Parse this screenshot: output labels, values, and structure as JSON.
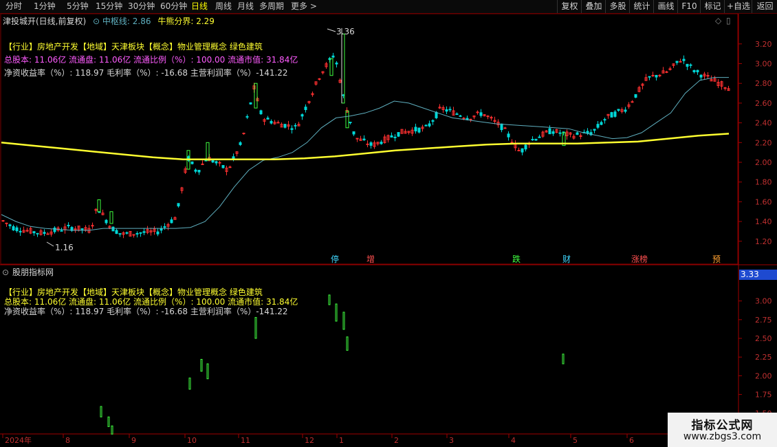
{
  "toolbar": {
    "periods": [
      "分时",
      "1分钟",
      "5分钟",
      "15分钟",
      "30分钟",
      "60分钟",
      "日线",
      "周线",
      "月线",
      "多周期",
      "更多 >"
    ],
    "active": "日线",
    "buttons": [
      "复权",
      "叠加",
      "多股",
      "统计",
      "画线",
      "F10",
      "标记",
      "+自选",
      "返回"
    ]
  },
  "main": {
    "stock_title": "津投城开(日线,前复权)",
    "zhongshu_label": "中枢线:",
    "zhongshu_value": "2.86",
    "niuxiong_label": "牛熊分界:",
    "niuxiong_value": "2.29",
    "info_line1": "【行业】房地产开发【地域】天津板块【概念】物业管理概念 绿色建筑",
    "info_line2": "总股本: 11.06亿 流通盘: 11.06亿 流通比例（%）: 100.00 流通市值: 31.84亿",
    "info_line3": "净资收益率（%）: 118.97 毛利率（%）: -16.68 主营利润率（%）-141.22",
    "high_label": "3.36",
    "low_label": "1.16",
    "event_tags": [
      "停",
      "增",
      "跌",
      "财",
      "涨榜",
      "预"
    ]
  },
  "indicator": {
    "title": "股朋指标网",
    "current_value": "3.33",
    "info_line1": "【行业】房地产开发【地域】天津板块【概念】物业管理概念 绿色建筑",
    "info_line2": "总股本: 11.06亿 流通盘: 11.06亿 流通比例（%）: 100.00 流通市值: 31.84亿",
    "info_line3": "净资收益率（%）: 118.97 毛利率（%）: -16.68 主营利润率（%）-141.22"
  },
  "x_axis_labels": [
    "2024年",
    "8",
    "9",
    "10",
    "11",
    "12",
    "1",
    "2",
    "3",
    "4",
    "5",
    "6"
  ],
  "watermark": {
    "line1": "指标公式网",
    "line2": "www.zbgs3.com"
  },
  "chart_data": [
    {
      "type": "candlestick",
      "title": "津投城开(日线,前复权)",
      "ylim": [
        1.08,
        3.38
      ],
      "yticks": [
        1.2,
        1.4,
        1.6,
        1.8,
        2.0,
        2.2,
        2.4,
        2.6,
        2.8,
        3.0,
        3.2
      ],
      "x_labels": [
        "2024年",
        "8",
        "9",
        "10",
        "11",
        "12",
        "1",
        "2",
        "3",
        "4",
        "5",
        "6"
      ],
      "series": [
        {
          "name": "中枢线",
          "color": "#5fb0c0",
          "values": [
            1.47,
            1.4,
            1.35,
            1.33,
            1.32,
            1.31,
            1.31,
            1.33,
            1.33,
            1.33,
            1.33,
            1.33,
            1.33,
            1.34,
            1.4,
            1.55,
            1.75,
            1.92,
            2.02,
            2.05,
            2.1,
            2.2,
            2.35,
            2.45,
            2.47,
            2.5,
            2.55,
            2.62,
            2.6,
            2.55,
            2.5,
            2.45,
            2.43,
            2.41,
            2.39,
            2.38,
            2.37,
            2.36,
            2.35,
            2.34,
            2.3,
            2.27,
            2.24,
            2.25,
            2.3,
            2.4,
            2.5,
            2.7,
            2.83,
            2.86,
            2.86
          ]
        },
        {
          "name": "牛熊分界",
          "color": "#ffff30",
          "values": [
            2.2,
            2.17,
            2.14,
            2.11,
            2.08,
            2.05,
            2.03,
            2.03,
            2.03,
            2.03,
            2.04,
            2.06,
            2.09,
            2.12,
            2.14,
            2.16,
            2.18,
            2.19,
            2.19,
            2.19,
            2.2,
            2.21,
            2.24,
            2.27,
            2.29
          ]
        }
      ],
      "high": 3.36,
      "low": 1.16
    },
    {
      "type": "bar",
      "title": "股朋指标网",
      "ylim": [
        1.25,
        3.3
      ],
      "yticks": [
        1.5,
        1.75,
        2.0,
        2.25,
        2.5,
        2.75,
        3.0
      ],
      "values": [
        {
          "x": 146,
          "y1": 1.59,
          "y2": 1.45
        },
        {
          "x": 157,
          "y1": 1.45,
          "y2": 1.32
        },
        {
          "x": 162,
          "y1": 1.33,
          "y2": 1.22
        },
        {
          "x": 275,
          "y1": 1.97,
          "y2": 1.82
        },
        {
          "x": 292,
          "y1": 2.22,
          "y2": 2.06
        },
        {
          "x": 301,
          "y1": 2.16,
          "y2": 1.96
        },
        {
          "x": 371,
          "y1": 2.78,
          "y2": 2.5
        },
        {
          "x": 478,
          "y1": 3.08,
          "y2": 2.95
        },
        {
          "x": 488,
          "y1": 2.96,
          "y2": 2.73
        },
        {
          "x": 499,
          "y1": 2.85,
          "y2": 2.62
        },
        {
          "x": 504,
          "y1": 2.52,
          "y2": 2.34
        },
        {
          "x": 818,
          "y1": 2.29,
          "y2": 2.16
        }
      ]
    }
  ]
}
